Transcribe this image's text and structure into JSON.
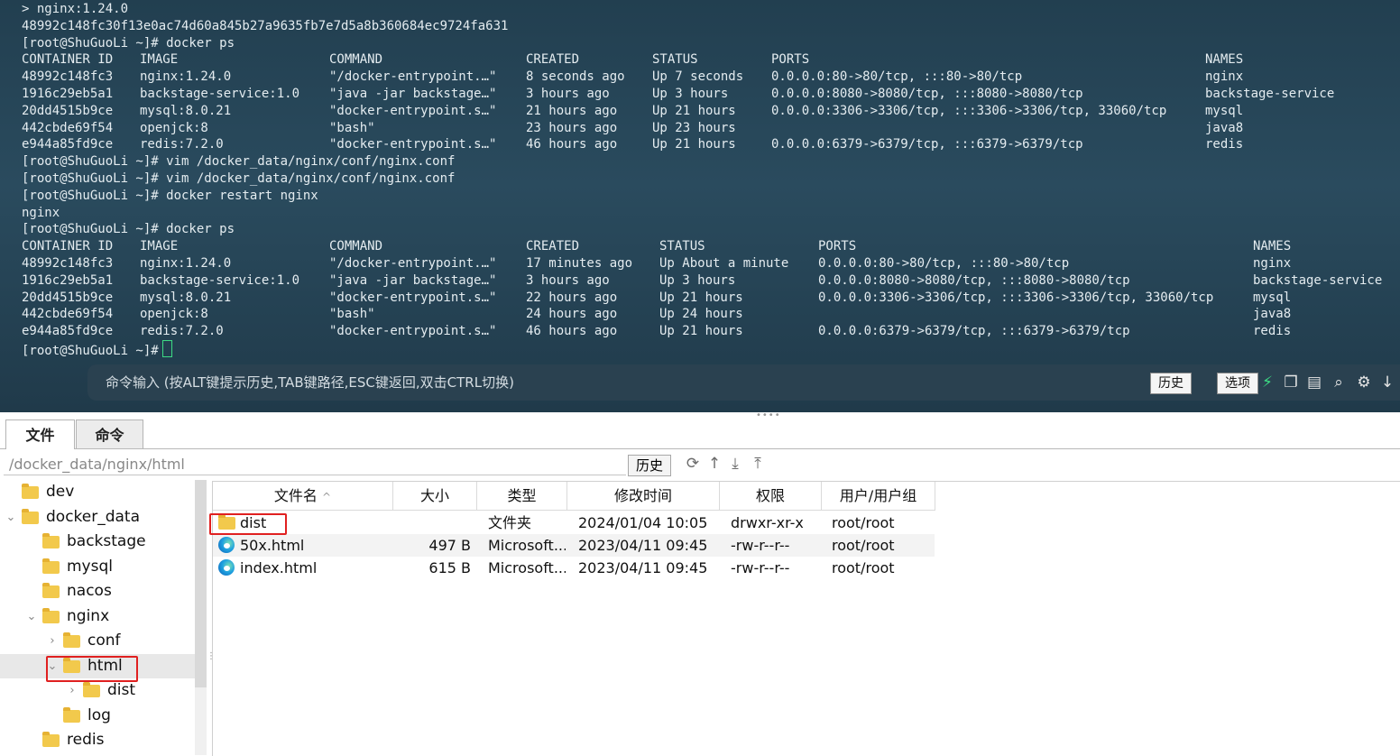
{
  "terminal": {
    "lines": [
      {
        "cells": [
          {
            "text": "> nginx:1.24.0"
          }
        ]
      },
      {
        "cells": [
          {
            "text": "48992c148fc30f13e0ac74d60a845b27a9635fb7e7d5a8b360684ec9724fa631"
          }
        ]
      },
      {
        "cells": [
          {
            "text": "[root@ShuGuoLi ~]# docker ps"
          }
        ]
      },
      {
        "cells": [
          {
            "text": "CONTAINER ID"
          },
          {
            "text": "IMAGE"
          },
          {
            "text": "COMMAND"
          },
          {
            "text": "CREATED"
          },
          {
            "text": "STATUS"
          },
          {
            "text": "PORTS"
          },
          {
            "text": "NAMES"
          }
        ]
      },
      {
        "cells": [
          {
            "text": "48992c148fc3"
          },
          {
            "text": "nginx:1.24.0"
          },
          {
            "text": "\"/docker-entrypoint.…\""
          },
          {
            "text": "8 seconds ago"
          },
          {
            "text": "Up 7 seconds"
          },
          {
            "text": "0.0.0.0:80->80/tcp, :::80->80/tcp"
          },
          {
            "text": "nginx"
          }
        ]
      },
      {
        "cells": [
          {
            "text": "1916c29eb5a1"
          },
          {
            "text": "backstage-service:1.0"
          },
          {
            "text": "\"java -jar backstage…\""
          },
          {
            "text": "3 hours ago"
          },
          {
            "text": "Up 3 hours"
          },
          {
            "text": "0.0.0.0:8080->8080/tcp, :::8080->8080/tcp"
          },
          {
            "text": "backstage-service"
          }
        ]
      },
      {
        "cells": [
          {
            "text": "20dd4515b9ce"
          },
          {
            "text": "mysql:8.0.21"
          },
          {
            "text": "\"docker-entrypoint.s…\""
          },
          {
            "text": "21 hours ago"
          },
          {
            "text": "Up 21 hours"
          },
          {
            "text": "0.0.0.0:3306->3306/tcp, :::3306->3306/tcp, 33060/tcp"
          },
          {
            "text": "mysql"
          }
        ]
      },
      {
        "cells": [
          {
            "text": "442cbde69f54"
          },
          {
            "text": "openjck:8"
          },
          {
            "text": "\"bash\""
          },
          {
            "text": "23 hours ago"
          },
          {
            "text": "Up 23 hours"
          },
          {
            "text": ""
          },
          {
            "text": "java8"
          }
        ]
      },
      {
        "cells": [
          {
            "text": "e944a85fd9ce"
          },
          {
            "text": "redis:7.2.0"
          },
          {
            "text": "\"docker-entrypoint.s…\""
          },
          {
            "text": "46 hours ago"
          },
          {
            "text": "Up 21 hours"
          },
          {
            "text": "0.0.0.0:6379->6379/tcp, :::6379->6379/tcp"
          },
          {
            "text": "redis"
          }
        ]
      },
      {
        "cells": [
          {
            "text": "[root@ShuGuoLi ~]# vim /docker_data/nginx/conf/nginx.conf"
          }
        ]
      },
      {
        "cells": [
          {
            "text": "[root@ShuGuoLi ~]# vim /docker_data/nginx/conf/nginx.conf"
          }
        ]
      },
      {
        "cells": [
          {
            "text": "[root@ShuGuoLi ~]# docker restart nginx"
          }
        ]
      },
      {
        "cells": [
          {
            "text": "nginx"
          }
        ]
      },
      {
        "cells": [
          {
            "text": "[root@ShuGuoLi ~]# docker ps"
          }
        ]
      },
      {
        "cells": [
          {
            "text": "CONTAINER ID"
          },
          {
            "text": "IMAGE"
          },
          {
            "text": "COMMAND"
          },
          {
            "text": "CREATED"
          },
          {
            "text": "STATUS"
          },
          {
            "text": "PORTS"
          },
          {
            "text": "NAMES"
          }
        ]
      },
      {
        "cells": [
          {
            "text": "48992c148fc3"
          },
          {
            "text": "nginx:1.24.0"
          },
          {
            "text": "\"/docker-entrypoint.…\""
          },
          {
            "text": "17 minutes ago"
          },
          {
            "text": "Up About a minute"
          },
          {
            "text": "0.0.0.0:80->80/tcp, :::80->80/tcp"
          },
          {
            "text": "nginx"
          }
        ]
      },
      {
        "cells": [
          {
            "text": "1916c29eb5a1"
          },
          {
            "text": "backstage-service:1.0"
          },
          {
            "text": "\"java -jar backstage…\""
          },
          {
            "text": "3 hours ago"
          },
          {
            "text": "Up 3 hours"
          },
          {
            "text": "0.0.0.0:8080->8080/tcp, :::8080->8080/tcp"
          },
          {
            "text": "backstage-service"
          }
        ]
      },
      {
        "cells": [
          {
            "text": "20dd4515b9ce"
          },
          {
            "text": "mysql:8.0.21"
          },
          {
            "text": "\"docker-entrypoint.s…\""
          },
          {
            "text": "22 hours ago"
          },
          {
            "text": "Up 21 hours"
          },
          {
            "text": "0.0.0.0:3306->3306/tcp, :::3306->3306/tcp, 33060/tcp"
          },
          {
            "text": "mysql"
          }
        ]
      },
      {
        "cells": [
          {
            "text": "442cbde69f54"
          },
          {
            "text": "openjck:8"
          },
          {
            "text": "\"bash\""
          },
          {
            "text": "24 hours ago"
          },
          {
            "text": "Up 24 hours"
          },
          {
            "text": ""
          },
          {
            "text": "java8"
          }
        ]
      },
      {
        "cells": [
          {
            "text": "e944a85fd9ce"
          },
          {
            "text": "redis:7.2.0"
          },
          {
            "text": "\"docker-entrypoint.s…\""
          },
          {
            "text": "46 hours ago"
          },
          {
            "text": "Up 21 hours"
          },
          {
            "text": "0.0.0.0:6379->6379/tcp, :::6379->6379/tcp"
          },
          {
            "text": "redis"
          }
        ]
      },
      {
        "cells": [
          {
            "text": "[root@ShuGuoLi ~]#"
          }
        ]
      }
    ],
    "cursor_color": "#3ddc84"
  },
  "command_bar": {
    "hint": "命令输入 (按ALT键提示历史,TAB键路径,ESC键返回,双击CTRL切换)",
    "history_label": "历史",
    "options_label": "选项",
    "icons": [
      "lightning-icon",
      "copy-icon",
      "paste-icon",
      "search-icon",
      "gear-icon",
      "arrow-down-icon"
    ]
  },
  "tabs": [
    {
      "label": "文件",
      "active": true
    },
    {
      "label": "命令",
      "active": false
    }
  ],
  "pathbar": {
    "path": "/docker_data/nginx/html",
    "history_label": "历史",
    "icons": [
      "refresh-icon",
      "up-icon",
      "download-icon",
      "upload-icon"
    ]
  },
  "tree": [
    {
      "label": "dev",
      "depth": 1,
      "expanded": null
    },
    {
      "label": "docker_data",
      "depth": 0,
      "expanded": true
    },
    {
      "label": "backstage",
      "depth": 2,
      "expanded": null
    },
    {
      "label": "mysql",
      "depth": 2,
      "expanded": null
    },
    {
      "label": "nacos",
      "depth": 2,
      "expanded": null
    },
    {
      "label": "nginx",
      "depth": 1.6,
      "expanded": true
    },
    {
      "label": "conf",
      "depth": 2.6,
      "expanded": false
    },
    {
      "label": "html",
      "depth": 2.6,
      "expanded": true,
      "selected": true
    },
    {
      "label": "dist",
      "depth": 3.6,
      "expanded": false
    },
    {
      "label": "log",
      "depth": 3,
      "expanded": null
    },
    {
      "label": "redis",
      "depth": 2,
      "expanded": null
    }
  ],
  "files": {
    "columns": [
      "文件名",
      "大小",
      "类型",
      "修改时间",
      "权限",
      "用户/用户组"
    ],
    "sort_indicator": "^",
    "rows": [
      {
        "name": "dist",
        "icon": "folder-icon",
        "size": "",
        "type": "文件夹",
        "modified": "2024/01/04 10:05",
        "perm": "drwxr-xr-x",
        "owner": "root/root"
      },
      {
        "name": "50x.html",
        "icon": "edge-icon",
        "size": "497 B",
        "type": "Microsoft...",
        "modified": "2023/04/11 09:45",
        "perm": "-rw-r--r--",
        "owner": "root/root"
      },
      {
        "name": "index.html",
        "icon": "edge-icon",
        "size": "615 B",
        "type": "Microsoft...",
        "modified": "2023/04/11 09:45",
        "perm": "-rw-r--r--",
        "owner": "root/root"
      }
    ]
  },
  "highlight_color": "#e02020"
}
